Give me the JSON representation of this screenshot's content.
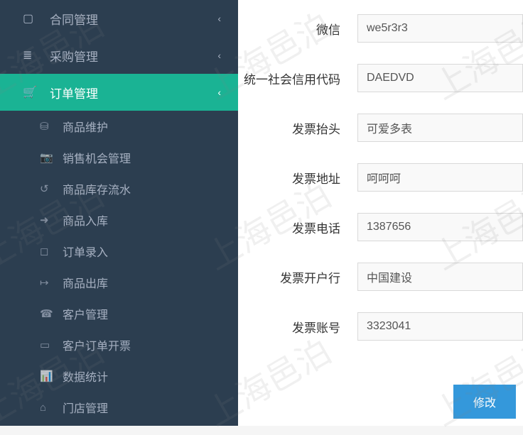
{
  "watermark": "上海邑泊",
  "sidebar": {
    "top": [
      {
        "icon": "▢",
        "label": "合同管理",
        "chevron": "‹"
      },
      {
        "icon": "≣",
        "label": "采购管理",
        "chevron": "‹"
      },
      {
        "icon": "🛒",
        "label": "订单管理",
        "chevron": "‹",
        "active": true
      }
    ],
    "sub": [
      {
        "icon": "⛁",
        "label": "商品维护"
      },
      {
        "icon": "📷",
        "label": "销售机会管理"
      },
      {
        "icon": "↺",
        "label": "商品库存流水"
      },
      {
        "icon": "➜",
        "label": "商品入库"
      },
      {
        "icon": "◻",
        "label": "订单录入"
      },
      {
        "icon": "↦",
        "label": "商品出库"
      },
      {
        "icon": "☎",
        "label": "客户管理"
      },
      {
        "icon": "▭",
        "label": "客户订单开票"
      },
      {
        "icon": "📊",
        "label": "数据统计"
      },
      {
        "icon": "⌂",
        "label": "门店管理"
      }
    ]
  },
  "form": {
    "rows": [
      {
        "label": "微信",
        "value": "we5r3r3"
      },
      {
        "label": "统一社会信用代码",
        "value": "DAEDVD"
      },
      {
        "label": "发票抬头",
        "value": "可爱多表"
      },
      {
        "label": "发票地址",
        "value": "呵呵呵"
      },
      {
        "label": "发票电话",
        "value": "1387656"
      },
      {
        "label": "发票开户行",
        "value": "中国建设"
      },
      {
        "label": "发票账号",
        "value": "3323041"
      }
    ]
  },
  "buttons": {
    "edit": "修改"
  }
}
